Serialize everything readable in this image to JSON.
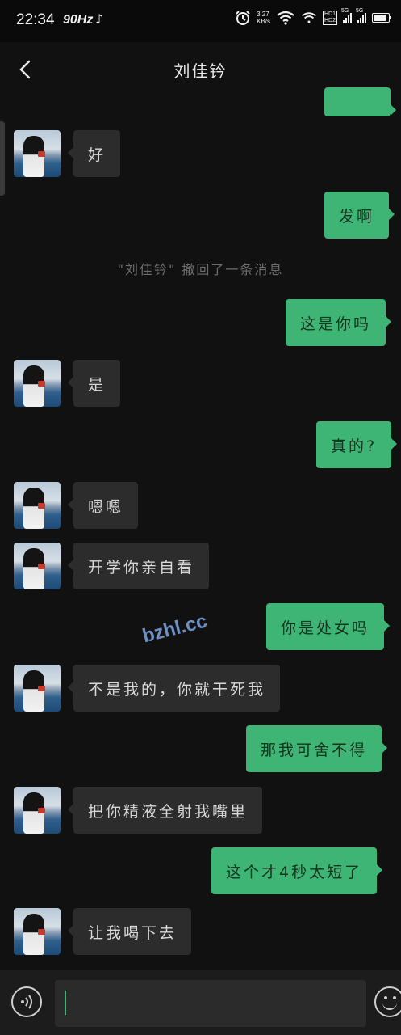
{
  "status_bar": {
    "time": "22:34",
    "refresh_rate": "90Hz",
    "net_speed_value": "3.27",
    "net_speed_unit": "KB/s",
    "hd1": "HD1",
    "hd2": "HD2",
    "net_type_1": "5G",
    "net_type_2": "5G",
    "icons": [
      "tiktok-icon",
      "alarm-icon",
      "wifi-icon",
      "signal-icon",
      "battery-icon"
    ]
  },
  "header": {
    "title": "刘佳钤",
    "back_icon": "chevron-left-icon"
  },
  "messages": [
    {
      "side": "out",
      "text": "",
      "partial": true
    },
    {
      "side": "in",
      "text": "好"
    },
    {
      "side": "out",
      "text": "发啊"
    },
    {
      "side": "system",
      "text": "\"刘佳钤\" 撤回了一条消息"
    },
    {
      "side": "out",
      "text": "这是你吗"
    },
    {
      "side": "in",
      "text": "是"
    },
    {
      "side": "out",
      "text": "真的?"
    },
    {
      "side": "in",
      "text": "嗯嗯"
    },
    {
      "side": "in",
      "text": "开学你亲自看"
    },
    {
      "side": "out",
      "text": "你是处女吗"
    },
    {
      "side": "in",
      "text": "不是我的，你就干死我"
    },
    {
      "side": "out",
      "text": "那我可舍不得"
    },
    {
      "side": "in",
      "text": "把你精液全射我嘴里"
    },
    {
      "side": "out",
      "text": "这个才4秒太短了"
    },
    {
      "side": "in",
      "text": "让我喝下去"
    }
  ],
  "watermark": "bzhl.cc",
  "input_bar": {
    "value": "",
    "voice_icon": "voice-icon",
    "emoji_icon": "emoji-icon"
  },
  "colors": {
    "background": "#111111",
    "incoming_bubble": "#2c2c2c",
    "outgoing_bubble": "#3eb575",
    "system_text": "#6d6d6d"
  }
}
